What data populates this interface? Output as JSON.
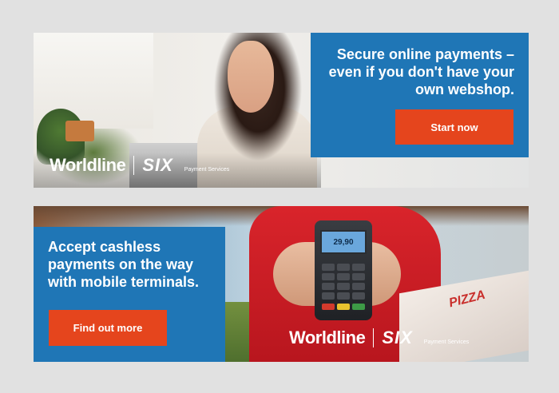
{
  "banners": [
    {
      "headline": "Secure online payments – even if you don't have your own webshop.",
      "button": "Start now",
      "brand": {
        "name": "Worldline",
        "partner": "SIX",
        "tagline": "Payment Services"
      }
    },
    {
      "headline": "Accept cashless payments on the way with mobile terminals.",
      "button": "Find out more",
      "brand": {
        "name": "Worldline",
        "partner": "SIX",
        "tagline": "Payment Services"
      },
      "terminal_screen": "29,90",
      "box_text": "PIZZA"
    }
  ],
  "colors": {
    "panel_blue": "#1f76b6",
    "cta_orange": "#e5451d",
    "page_bg": "#e1e1e1"
  }
}
